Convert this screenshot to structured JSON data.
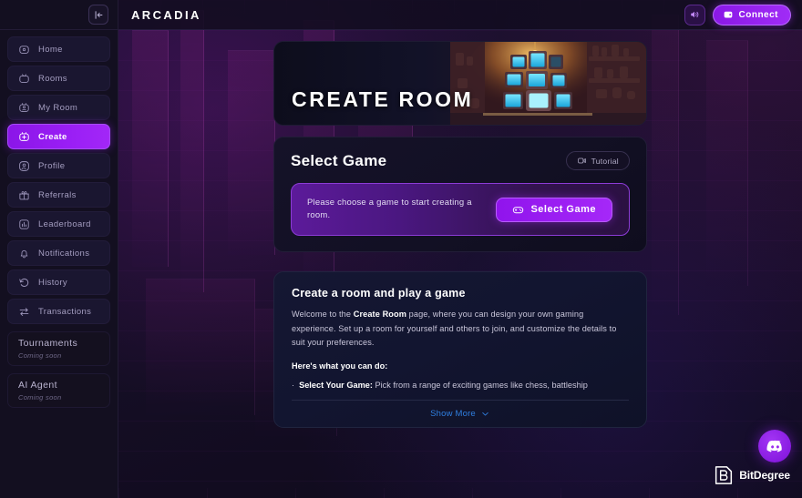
{
  "app": {
    "brand": "ARCADIA"
  },
  "sidebar": {
    "collapse_icon": "collapse-left-icon",
    "items": [
      {
        "label": "Home",
        "icon": "home-tv-icon",
        "active": false
      },
      {
        "label": "Rooms",
        "icon": "rooms-tv-icon",
        "active": false
      },
      {
        "label": "My Room",
        "icon": "my-room-tv-icon",
        "active": false
      },
      {
        "label": "Create",
        "icon": "create-plus-tv-icon",
        "active": true
      },
      {
        "label": "Profile",
        "icon": "profile-user-icon",
        "active": false
      },
      {
        "label": "Referrals",
        "icon": "gift-icon",
        "active": false
      },
      {
        "label": "Leaderboard",
        "icon": "bar-chart-icon",
        "active": false
      },
      {
        "label": "Notifications",
        "icon": "bell-icon",
        "active": false
      },
      {
        "label": "History",
        "icon": "history-undo-icon",
        "active": false
      },
      {
        "label": "Transactions",
        "icon": "transfer-arrows-icon",
        "active": false
      }
    ],
    "coming_soon": [
      {
        "title": "Tournaments",
        "subtitle": "Coming soon"
      },
      {
        "title": "AI Agent",
        "subtitle": "Coming soon"
      }
    ]
  },
  "topbar": {
    "sound_icon": "speaker-volume-icon",
    "connect_label": "Connect",
    "connect_icon": "wallet-icon"
  },
  "banner": {
    "title": "CREATE ROOM"
  },
  "select_game": {
    "title": "Select Game",
    "tutorial_label": "Tutorial",
    "tutorial_icon": "video-tutorial-icon",
    "message": "Please choose a game to start creating a room.",
    "button_label": "Select Game",
    "button_icon": "gamepad-icon"
  },
  "info": {
    "title": "Create a room and play a game",
    "paragraph_1": "Welcome to the ",
    "paragraph_bold": "Create Room",
    "paragraph_2": " page, where you can design your own gaming experience. Set up a room for yourself and others to join, and customize the details to suit your preferences.",
    "subheading": "Here's what you can do:",
    "bullet_dot": "·",
    "bullet_bold": "Select Your Game:",
    "bullet_text": " Pick from a range of exciting games like chess, battleship",
    "show_more_label": "Show More",
    "show_more_icon": "chevron-down-icon"
  },
  "watermark": {
    "logo_icon": "bitdegree-shield-icon",
    "text": "BitDegree",
    "discord_icon": "discord-icon"
  },
  "colors": {
    "accent_purple": "#a02cf6",
    "accent_purple_dark": "#8a18e6",
    "panel_bg": "#151228",
    "sidebar_bg": "#130f20",
    "link_blue": "#2f7fe0",
    "text_muted": "#a49dc0"
  }
}
